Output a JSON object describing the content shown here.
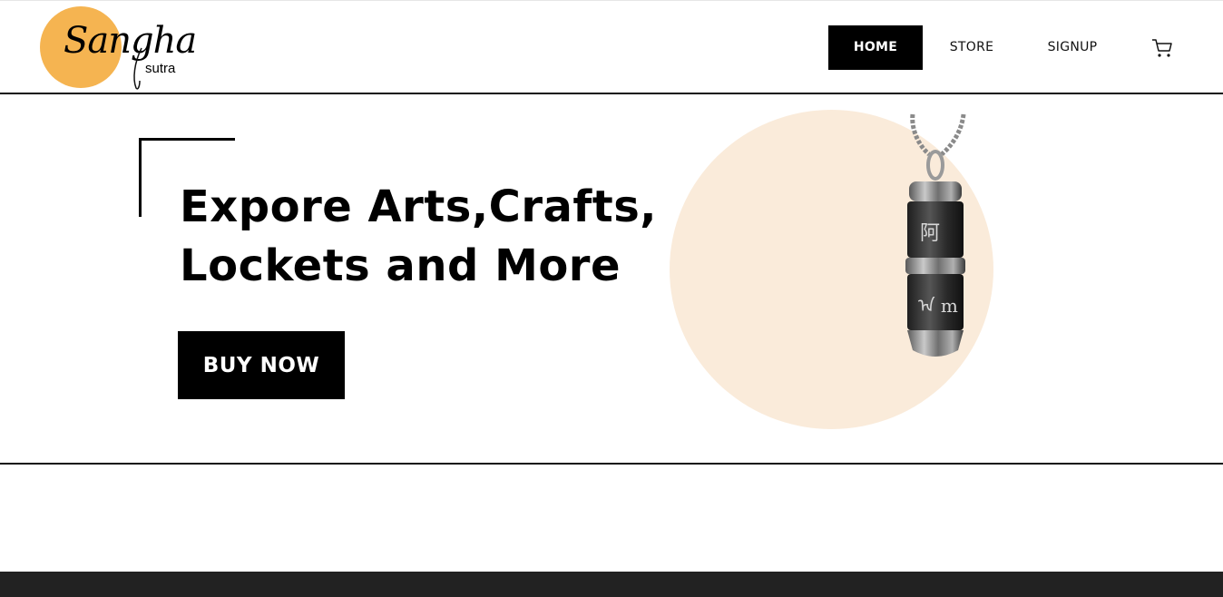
{
  "brand": {
    "logo_script": "Sangha",
    "logo_sub": "sutra",
    "logo_circle_color": "#F5B451"
  },
  "nav": {
    "items": [
      {
        "label": "HOME",
        "active": true
      },
      {
        "label": "STORE",
        "active": false
      },
      {
        "label": "SIGNUP",
        "active": false
      }
    ],
    "cart_icon": "cart-icon"
  },
  "hero": {
    "title_line1": "Expore Arts,Crafts,",
    "title_line2": "Lockets and More",
    "cta_label": "BUY NOW",
    "circle_color": "#FAEBDA",
    "product_image": "locket-pendant"
  },
  "footer": {
    "bar_color": "#222222"
  }
}
